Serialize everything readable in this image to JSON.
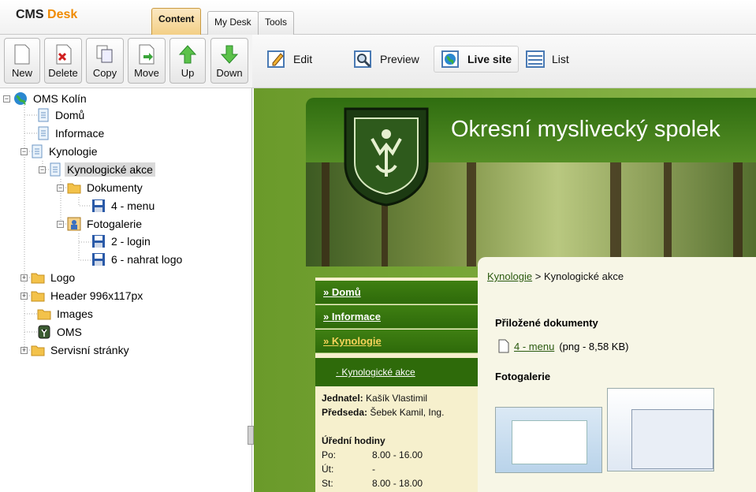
{
  "app": {
    "name_a": "CMS",
    "name_b": "Desk"
  },
  "tabs": [
    {
      "label": "Content",
      "active": true
    },
    {
      "label": "My Desk"
    },
    {
      "label": "Tools"
    }
  ],
  "toolbar": {
    "new": "New",
    "delete": "Delete",
    "copy": "Copy",
    "move": "Move",
    "up": "Up",
    "down": "Down"
  },
  "view": {
    "edit": "Edit",
    "preview": "Preview",
    "live": "Live site",
    "list": "List"
  },
  "tree": {
    "root": "OMS Kolín",
    "items": [
      "Domů",
      "Informace",
      "Kynologie",
      "Kynologické akce",
      "Dokumenty",
      "4 - menu",
      "Fotogalerie",
      "2 - login",
      "6 - nahrat logo",
      "Logo",
      "Header 996x117px",
      "Images",
      "OMS",
      "Servisní stránky"
    ]
  },
  "site": {
    "title": "Okresní myslivecký spolek",
    "menu": [
      "» Domů",
      "» Informace",
      "» Kynologie"
    ],
    "submenu": "· Kynologické akce",
    "jednatel_label": "Jednatel:",
    "jednatel": "Kašík Vlastimil",
    "predseda_label": "Předseda:",
    "predseda": "Šebek Kamil, Ing.",
    "hours_title": "Úřední hodiny",
    "hours": [
      {
        "day": "Po:",
        "time": "8.00 - 16.00"
      },
      {
        "day": "Út:",
        "time": "-"
      },
      {
        "day": "St:",
        "time": "8.00 - 18.00"
      }
    ],
    "breadcrumb_link": "Kynologie",
    "breadcrumb_rest": "> Kynologické akce",
    "attached_title": "Přiložené dokumenty",
    "doc_link": "4 - menu",
    "doc_meta": "(png - 8,58 KB)",
    "gallery_title": "Fotogalerie"
  },
  "colors": {
    "accent": "#f08a00",
    "green_dark": "#2e6a0a",
    "green_light": "#8ab64a"
  }
}
